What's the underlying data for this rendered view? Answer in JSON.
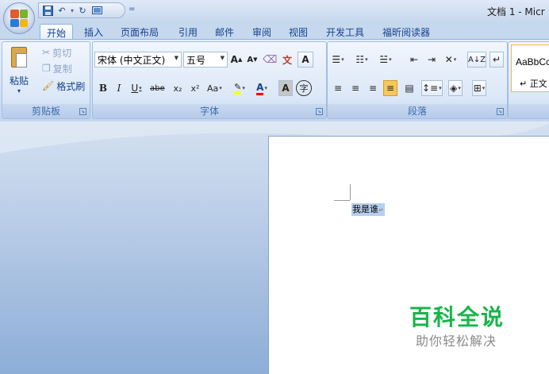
{
  "window": {
    "title": "文档 1 - Micr"
  },
  "qat": {
    "icons": [
      "save-icon",
      "undo-icon",
      "redo-icon",
      "print-preview-icon"
    ],
    "more_glyph": "="
  },
  "tabs": [
    {
      "label": "开始",
      "active": true
    },
    {
      "label": "插入"
    },
    {
      "label": "页面布局"
    },
    {
      "label": "引用"
    },
    {
      "label": "邮件"
    },
    {
      "label": "审阅"
    },
    {
      "label": "视图"
    },
    {
      "label": "开发工具"
    },
    {
      "label": "福昕阅读器"
    }
  ],
  "clipboard": {
    "paste_label": "粘贴",
    "paste_arrow": "▾",
    "cut_label": "剪切",
    "copy_label": "复制",
    "format_painter_label": "格式刷",
    "group_label": "剪贴板"
  },
  "font": {
    "font_name": "宋体 (中文正文)",
    "font_size": "五号",
    "grow_label": "A",
    "shrink_label": "A",
    "bold_label": "B",
    "italic_label": "I",
    "underline_label": "U",
    "strike_label": "abe",
    "subscript_label": "x₂",
    "superscript_label": "x²",
    "change_case_label": "Aa",
    "group_label": "字体",
    "colors": {
      "highlight": "#ffff00",
      "font_color": "#ff0000"
    }
  },
  "paragraph": {
    "group_label": "段落"
  },
  "styles": {
    "sample_text": "AaBbCc",
    "normal_label": "↵ 正文"
  },
  "document": {
    "selected_text": "我是谁",
    "paragraph_mark": "↵"
  },
  "watermark": {
    "title": "百科全说",
    "subtitle": "助你轻松解决"
  }
}
